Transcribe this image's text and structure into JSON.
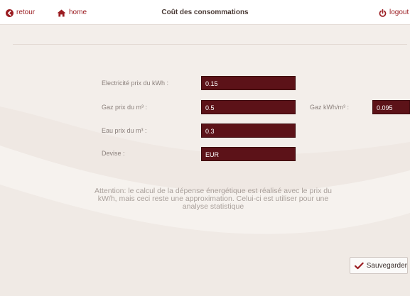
{
  "header": {
    "back_label": "retour",
    "home_label": "home",
    "title": "Coût des consommations",
    "logout_label": "logout"
  },
  "form": {
    "electricity": {
      "label": "Electricité prix du kWh :",
      "value": "0.15"
    },
    "gas": {
      "label": "Gaz prix du m³ :",
      "value": "0.5"
    },
    "gas_kwh": {
      "label": "Gaz kWh/m³ :",
      "value": "0.095"
    },
    "water": {
      "label": "Eau prix du m³ :",
      "value": "0.3"
    },
    "currency": {
      "label": "Devise :",
      "value": "EUR"
    }
  },
  "notice": "Attention: le calcul de la dépense énergétique est réalisé avec le prix du kW/h, mais ceci reste une approximation. Celui-ci est utiliser pour une analyse statistique",
  "actions": {
    "save_label": "Sauvegarder"
  },
  "colors": {
    "accent": "#9b1d22",
    "field_bg": "#5c1218",
    "background": "#f4f0ec"
  },
  "icons": {
    "back": "arrow-left-circle-icon",
    "home": "home-icon",
    "logout": "power-icon",
    "save": "checkmark-icon"
  }
}
